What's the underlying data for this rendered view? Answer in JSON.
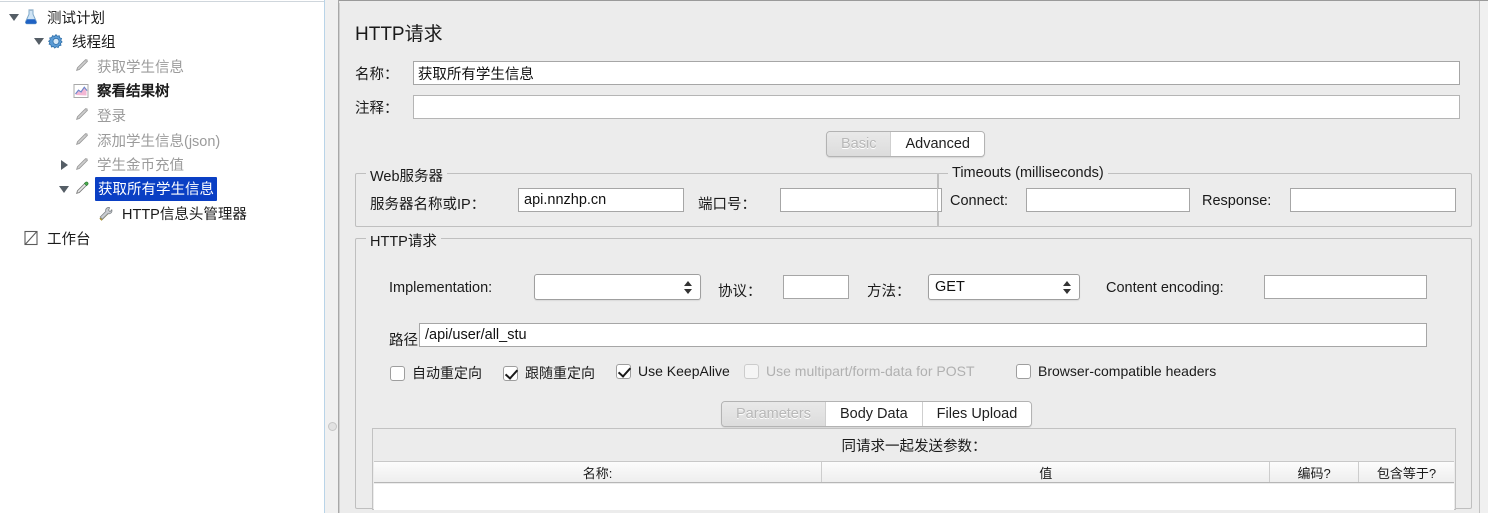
{
  "window": {
    "app": "JMeter"
  },
  "tree": {
    "items": [
      {
        "label": "测试计划",
        "icon": "flask-icon",
        "indent": 0,
        "toggle": "open",
        "state": "dark",
        "selected": false
      },
      {
        "label": "线程组",
        "icon": "gear-icon",
        "indent": 1,
        "toggle": "open",
        "state": "dark",
        "selected": false
      },
      {
        "label": "获取学生信息",
        "icon": "http-sampler-icon",
        "indent": 2,
        "toggle": "none",
        "state": "disabled",
        "selected": false
      },
      {
        "label": "察看结果树",
        "icon": "results-tree-icon",
        "indent": 2,
        "toggle": "none",
        "state": "bold",
        "selected": false
      },
      {
        "label": "登录",
        "icon": "http-sampler-icon",
        "indent": 2,
        "toggle": "none",
        "state": "disabled",
        "selected": false
      },
      {
        "label": "添加学生信息(json)",
        "icon": "http-sampler-icon",
        "indent": 2,
        "toggle": "none",
        "state": "disabled",
        "selected": false
      },
      {
        "label": "学生金币充值",
        "icon": "http-sampler-icon",
        "indent": 2,
        "toggle": "closed",
        "state": "disabled",
        "selected": false
      },
      {
        "label": "获取所有学生信息",
        "icon": "http-sampler-icon",
        "indent": 2,
        "toggle": "open",
        "state": "dark",
        "selected": true
      },
      {
        "label": "HTTP信息头管理器",
        "icon": "header-manager-icon",
        "indent": 3,
        "toggle": "none",
        "state": "dark",
        "selected": false
      },
      {
        "label": "工作台",
        "icon": "workbench-icon",
        "indent": 0,
        "toggle": "none",
        "state": "dark",
        "selected": false
      }
    ]
  },
  "main": {
    "title": "HTTP请求",
    "name_label": "名称：",
    "name_value": "获取所有学生信息",
    "comment_label": "注释：",
    "comment_value": "",
    "tabs": [
      {
        "label": "Basic",
        "selected": true
      },
      {
        "label": "Advanced",
        "selected": false
      }
    ],
    "web_server": {
      "title": "Web服务器",
      "server_label": "服务器名称或IP：",
      "server_value": "api.nnzhp.cn",
      "port_label": "端口号：",
      "port_value": ""
    },
    "timeouts": {
      "title": "Timeouts (milliseconds)",
      "connect_label": "Connect:",
      "connect_value": "",
      "response_label": "Response:",
      "response_value": ""
    },
    "http_request": {
      "title": "HTTP请求",
      "implementation_label": "Implementation:",
      "implementation_value": "",
      "protocol_label": "协议：",
      "protocol_value": "",
      "method_label": "方法：",
      "method_value": "GET",
      "content_encoding_label": "Content encoding:",
      "content_encoding_value": "",
      "path_label": "路径：",
      "path_value": "/api/user/all_stu",
      "checkboxes": [
        {
          "label": "自动重定向",
          "checked": false,
          "disabled": false
        },
        {
          "label": "跟随重定向",
          "checked": true,
          "disabled": false
        },
        {
          "label": "Use KeepAlive",
          "checked": true,
          "disabled": false
        },
        {
          "label": "Use multipart/form-data for POST",
          "checked": false,
          "disabled": true
        },
        {
          "label": "Browser-compatible headers",
          "checked": false,
          "disabled": false
        }
      ]
    },
    "param_tabs": [
      {
        "label": "Parameters",
        "selected": true
      },
      {
        "label": "Body Data",
        "selected": false
      },
      {
        "label": "Files Upload",
        "selected": false
      }
    ],
    "params_table": {
      "caption": "同请求一起发送参数：",
      "columns": [
        "名称:",
        "值",
        "编码?",
        "包含等于?"
      ],
      "rows": []
    }
  }
}
